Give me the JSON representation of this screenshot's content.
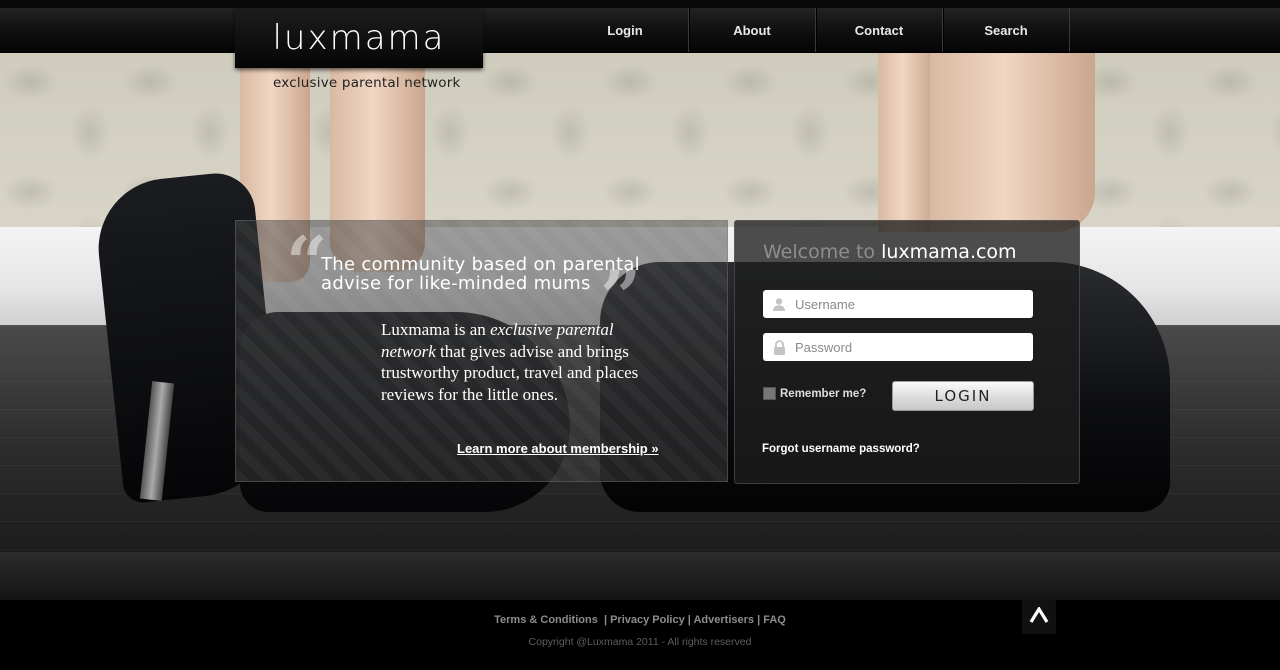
{
  "brand": {
    "logo": "luxmama",
    "tagline": "exclusive parental network"
  },
  "nav": {
    "items": [
      {
        "label": "Login"
      },
      {
        "label": "About"
      },
      {
        "label": "Contact"
      },
      {
        "label": "Search"
      }
    ]
  },
  "quote": {
    "open_mark": "“",
    "close_mark": "”",
    "heading": "The community based on parental advise for like-minded mums",
    "body_part1": "Luxmama is an ",
    "body_emphasis": "exclusive parental network",
    "body_part2": " that gives advise and brings trustworthy product, travel and places reviews for the little ones.",
    "learn_more": "Learn more about membership »"
  },
  "login": {
    "welcome_prefix": "Welcome to ",
    "welcome_site": "luxmama.com",
    "username_placeholder": "Username",
    "password_placeholder": "Password",
    "username_value": "",
    "password_value": "",
    "remember_label": "Remember me?",
    "remember_checked": false,
    "login_button": "LOGIN",
    "forgot_link": "Forgot username password?"
  },
  "footer": {
    "links": [
      "Terms & Conditions",
      "Privacy Policy",
      "Advertisers",
      "FAQ"
    ],
    "copyright": "Copyright @Luxmama 2011 - All rights reserved"
  },
  "icons": {
    "user": "user-icon",
    "lock": "lock-icon",
    "back_to_top": "chevron-up-icon"
  }
}
